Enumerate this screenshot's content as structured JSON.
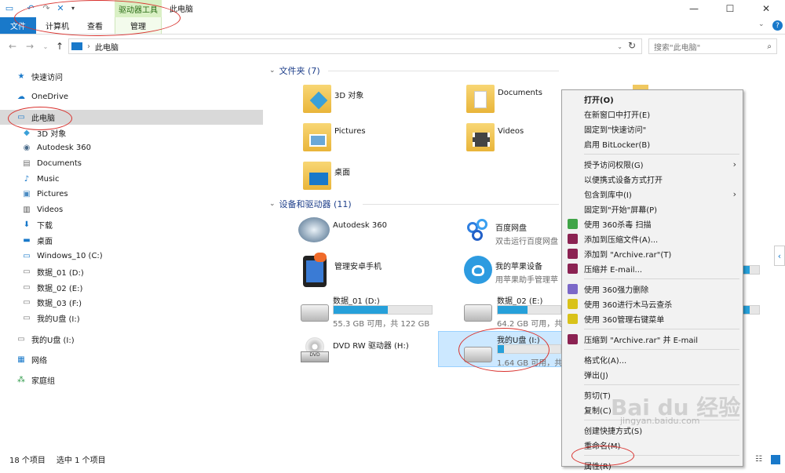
{
  "window": {
    "title": "此电脑",
    "context_tab_group": "驱动器工具",
    "controls": {
      "minimize": "—",
      "maximize": "☐",
      "close": "✕"
    }
  },
  "ribbon": {
    "tabs": [
      "文件",
      "计算机",
      "查看",
      "管理"
    ]
  },
  "address": {
    "path": "此电脑",
    "search_placeholder": "搜索\"此电脑\""
  },
  "nav": {
    "items": [
      {
        "label": "快速访问",
        "icon": "star-icon"
      },
      {
        "label": "OneDrive",
        "icon": "cloud-icon"
      },
      {
        "label": "此电脑",
        "icon": "pc-icon",
        "selected": true
      },
      {
        "label": "3D 对象",
        "icon": "cube-icon"
      },
      {
        "label": "Autodesk 360",
        "icon": "autodesk-icon"
      },
      {
        "label": "Documents",
        "icon": "document-icon"
      },
      {
        "label": "Music",
        "icon": "music-icon"
      },
      {
        "label": "Pictures",
        "icon": "picture-icon"
      },
      {
        "label": "Videos",
        "icon": "video-icon"
      },
      {
        "label": "下载",
        "icon": "download-icon"
      },
      {
        "label": "桌面",
        "icon": "desktop-icon"
      },
      {
        "label": "Windows_10 (C:)",
        "icon": "drive-icon"
      },
      {
        "label": "数据_01 (D:)",
        "icon": "drive-icon"
      },
      {
        "label": "数据_02 (E:)",
        "icon": "drive-icon"
      },
      {
        "label": "数据_03 (F:)",
        "icon": "drive-icon"
      },
      {
        "label": "我的U盘 (I:)",
        "icon": "drive-icon"
      },
      {
        "label": "我的U盘 (I:)",
        "icon": "drive-icon"
      },
      {
        "label": "网络",
        "icon": "network-icon"
      },
      {
        "label": "家庭组",
        "icon": "homegroup-icon"
      }
    ]
  },
  "content": {
    "folders_header": "文件夹 (7)",
    "folders": [
      "3D 对象",
      "Documents",
      "Pictures",
      "Videos",
      "桌面"
    ],
    "devices_header": "设备和驱动器 (11)",
    "devices": [
      {
        "name": "Autodesk 360",
        "sub": ""
      },
      {
        "name": "百度网盘",
        "sub": "双击运行百度网盘"
      },
      {
        "name": "管理安卓手机",
        "sub": ""
      },
      {
        "name": "我的苹果设备",
        "sub": "用苹果助手管理苹"
      },
      {
        "name": "数据_01 (D:)",
        "sub": "55.3 GB 可用，共 122 GB",
        "used": 0.55
      },
      {
        "name": "数据_02 (E:)",
        "sub": "64.2 GB 可用，共",
        "used": 0.47
      },
      {
        "name": "DVD RW 驱动器 (H:)",
        "sub": ""
      },
      {
        "name": "我的U盘 (I:)",
        "sub": "1.64 GB 可用，共",
        "used": 0.1
      }
    ]
  },
  "context_menu": {
    "items": [
      {
        "label": "打开(O)",
        "bold": true
      },
      {
        "label": "在新窗口中打开(E)"
      },
      {
        "label": "固定到\"快速访问\""
      },
      {
        "label": "启用 BitLocker(B)"
      },
      {
        "sep": true
      },
      {
        "label": "授予访问权限(G)",
        "submenu": true
      },
      {
        "label": "以便携式设备方式打开"
      },
      {
        "label": "包含到库中(I)",
        "submenu": true
      },
      {
        "label": "固定到\"开始\"屏幕(P)"
      },
      {
        "label": "使用 360杀毒 扫描",
        "icon": "shield-icon",
        "color": "#3fa447"
      },
      {
        "label": "添加到压缩文件(A)...",
        "icon": "rar-icon",
        "color": "#8b2252"
      },
      {
        "label": "添加到 \"Archive.rar\"(T)",
        "icon": "rar-icon",
        "color": "#8b2252"
      },
      {
        "label": "压缩并 E-mail...",
        "icon": "rar-icon",
        "color": "#8b2252"
      },
      {
        "sep": true
      },
      {
        "label": "使用 360强力删除",
        "icon": "delete-360-icon",
        "color": "#7b68c8"
      },
      {
        "label": "使用 360进行木马云查杀",
        "icon": "scan-360-icon",
        "color": "#d9c21a"
      },
      {
        "label": "使用 360管理右键菜单",
        "icon": "manage-360-icon",
        "color": "#d9c21a"
      },
      {
        "sep": true
      },
      {
        "label": "压缩到 \"Archive.rar\" 并 E-mail",
        "icon": "rar-icon",
        "color": "#8b2252"
      },
      {
        "sep": true
      },
      {
        "label": "格式化(A)..."
      },
      {
        "label": "弹出(J)"
      },
      {
        "sep": true
      },
      {
        "label": "剪切(T)"
      },
      {
        "label": "复制(C)"
      },
      {
        "sep": true
      },
      {
        "label": "创建快捷方式(S)"
      },
      {
        "label": "重命名(M)"
      },
      {
        "sep": true
      },
      {
        "label": "属性(R)"
      }
    ]
  },
  "status": {
    "count": "18 个项目",
    "selected": "选中 1 个项目"
  },
  "watermark": {
    "brand": "Bai du 经验",
    "url": "jingyan.baidu.com"
  },
  "colors": {
    "accent": "#1979ca",
    "progress": "#26a0da",
    "selection": "#cce8ff",
    "annotation": "#d9322e"
  }
}
